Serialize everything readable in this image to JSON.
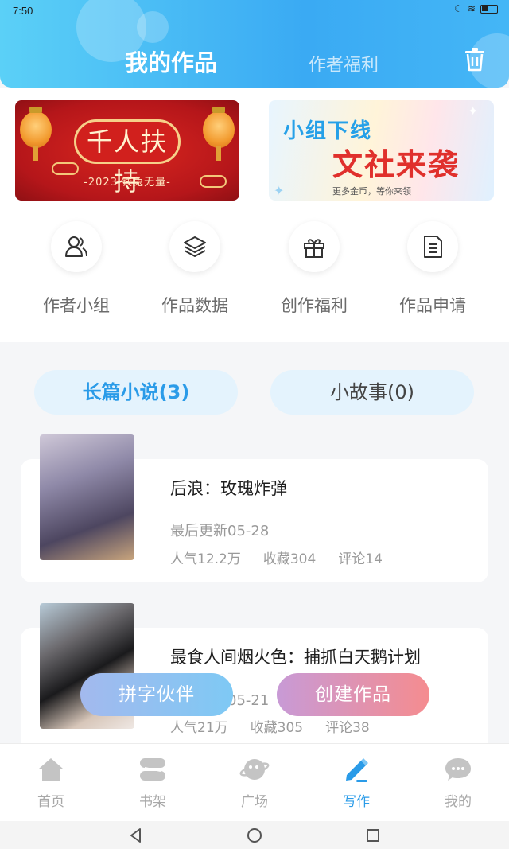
{
  "status_bar": {
    "time": "7:50"
  },
  "header": {
    "tab_active": "我的作品",
    "tab_inactive": "作者福利"
  },
  "banners": {
    "left": {
      "title": "千人扶持",
      "caption": "-2023 钱兔无量-"
    },
    "right": {
      "line1": "小组下线",
      "line2": "文社来袭",
      "caption": "更多金币，等你来领"
    }
  },
  "quick_menu": [
    {
      "label": "作者小组",
      "icon": "users-icon"
    },
    {
      "label": "作品数据",
      "icon": "layers-icon"
    },
    {
      "label": "创作福利",
      "icon": "gift-icon"
    },
    {
      "label": "作品申请",
      "icon": "document-icon"
    }
  ],
  "works_tabs": {
    "long": "长篇小说(3)",
    "short": "小故事(0)"
  },
  "books": [
    {
      "title": "后浪：玫瑰炸弹",
      "last_update": "最后更新05-28",
      "popularity": "人气12.2万",
      "favorites": "收藏304",
      "comments": "评论14"
    },
    {
      "title": "最食人间烟火色：捕抓白天鹅计划",
      "last_update": "最后更新05-21",
      "popularity": "人气21万",
      "favorites": "收藏305",
      "comments": "评论38"
    }
  ],
  "float_buttons": {
    "partner": "拼字伙伴",
    "create": "创建作品"
  },
  "bottom_nav": [
    {
      "label": "首页",
      "icon": "home-icon"
    },
    {
      "label": "书架",
      "icon": "bookshelf-icon"
    },
    {
      "label": "广场",
      "icon": "planet-icon"
    },
    {
      "label": "写作",
      "icon": "pen-icon",
      "active": true
    },
    {
      "label": "我的",
      "icon": "chat-icon"
    }
  ],
  "colors": {
    "accent": "#2a9be8",
    "header_start": "#5bd0f7",
    "header_end": "#3aaaf3"
  }
}
